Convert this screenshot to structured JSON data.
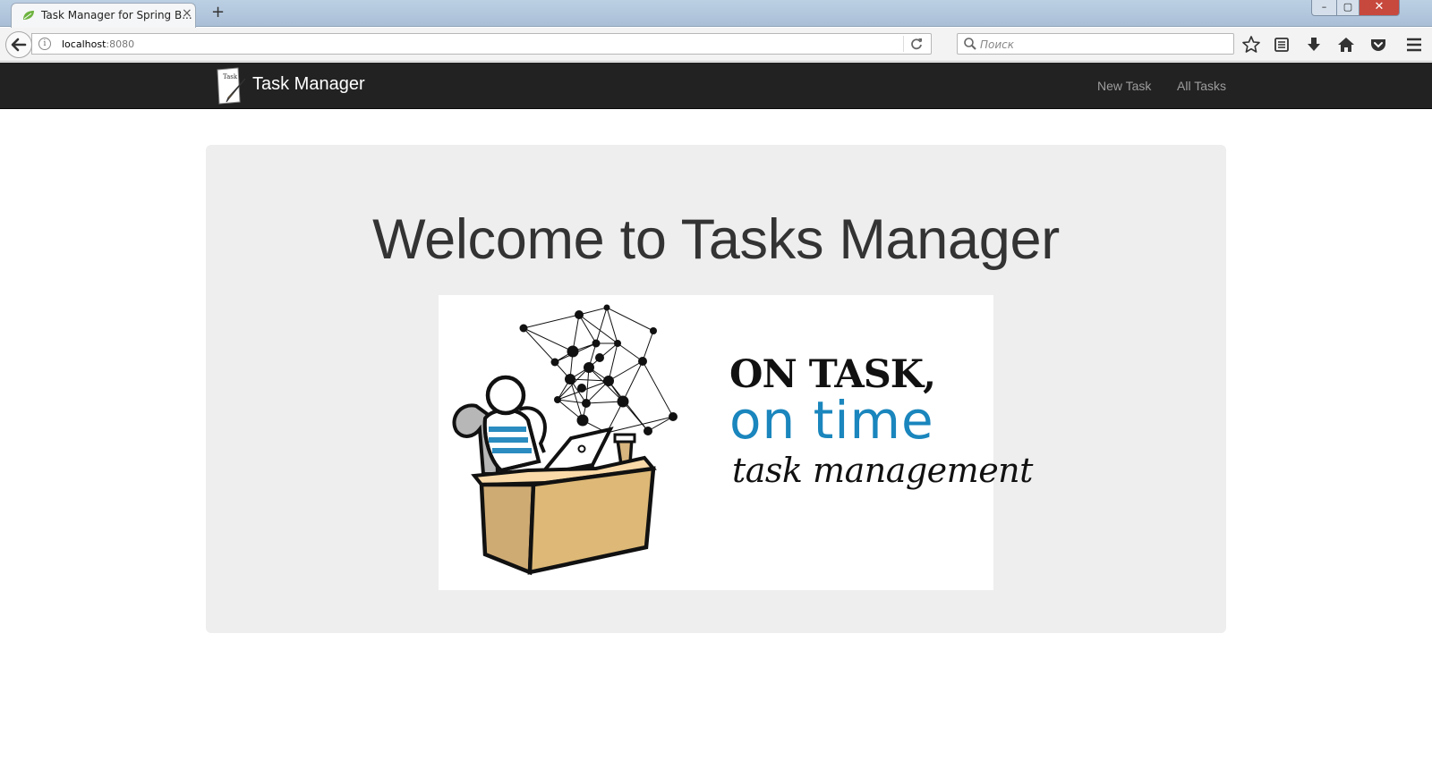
{
  "browser": {
    "tab_title": "Task Manager for Spring B...",
    "tab_close": "×",
    "new_tab": "+",
    "window_controls": {
      "minimize": "–",
      "maximize": "▢",
      "close": "✕"
    },
    "url_host": "localhost",
    "url_port": ":8080",
    "search_placeholder": "Поиск",
    "icons": [
      "back-arrow-icon",
      "info-icon",
      "reload-icon",
      "search-icon",
      "bookmark-star-icon",
      "reading-list-icon",
      "download-icon",
      "home-icon",
      "pocket-icon",
      "menu-icon"
    ]
  },
  "navbar": {
    "brand": "Task Manager",
    "logo_text": "Task",
    "links": [
      "New Task",
      "All Tasks"
    ],
    "background": "#222222",
    "link_color": "#9d9d9d"
  },
  "jumbotron": {
    "heading": "Welcome to Tasks Manager",
    "background": "#eeeeee",
    "image": {
      "line1": "ON TASK,",
      "line2": "on time",
      "line3": "task management",
      "accent_color": "#1a86bd"
    }
  }
}
